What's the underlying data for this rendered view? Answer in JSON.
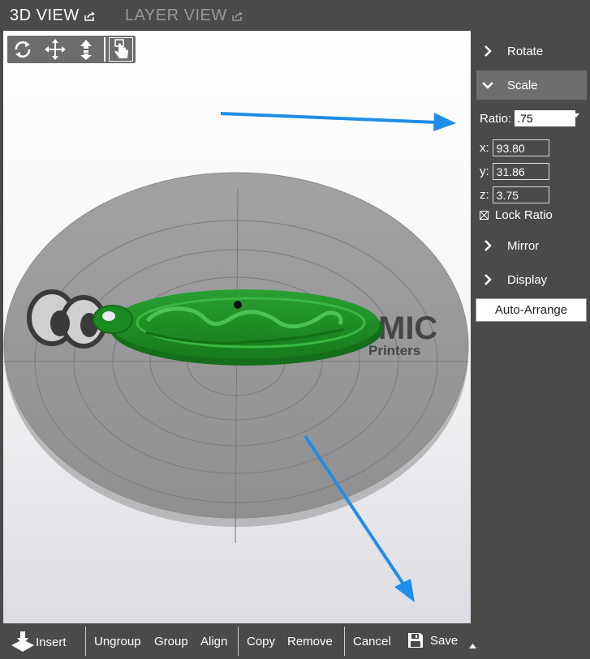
{
  "tabs": [
    {
      "label": "3D VIEW",
      "active": true
    },
    {
      "label": "LAYER VIEW",
      "active": false
    }
  ],
  "view_tools": [
    "rotate-view-icon",
    "pan-icon",
    "zoom-icon",
    "select-touch-icon"
  ],
  "sidebar": {
    "rotate_label": "Rotate",
    "scale_label": "Scale",
    "ratio_label": "Ratio:",
    "ratio_value": ".75",
    "x_label": "x:",
    "x_value": "93.80",
    "y_label": "y:",
    "y_value": "31.86",
    "z_label": "z:",
    "z_value": "3.75",
    "lock_ratio_label": "Lock Ratio",
    "lock_ratio_checked": true,
    "mirror_label": "Mirror",
    "display_label": "Display",
    "auto_arrange_label": "Auto-Arrange"
  },
  "bed": {
    "logo_text": "MIC",
    "logo_sub": "Printers"
  },
  "colors": {
    "panel": "#4a4a4a",
    "panel_active": "#6e6e6e",
    "model_green": "#1e8a24",
    "arrow_blue": "#1e8ee6",
    "bed_gray": "#9a9a9a"
  },
  "bottom": {
    "insert": "Insert",
    "ungroup": "Ungroup",
    "group": "Group",
    "align": "Align",
    "copy": "Copy",
    "remove": "Remove",
    "cancel": "Cancel",
    "save": "Save"
  }
}
